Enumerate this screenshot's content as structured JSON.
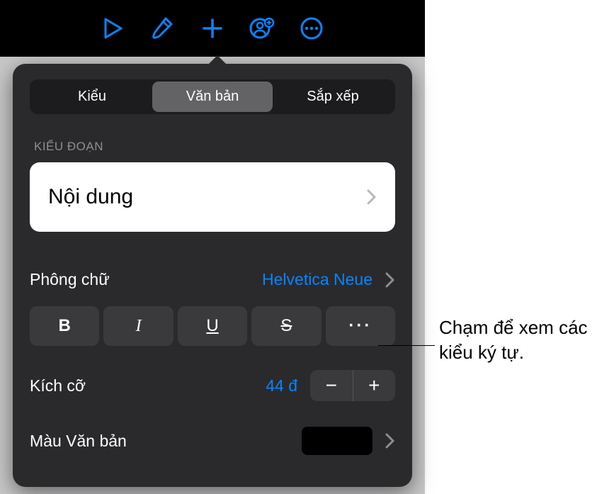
{
  "toolbar": {
    "play_icon": "play-icon",
    "brush_icon": "brush-icon",
    "add_icon": "add-icon",
    "collab_icon": "collab-icon",
    "more_icon": "more-icon"
  },
  "tabs": {
    "style": "Kiểu",
    "text": "Văn bản",
    "arrange": "Sắp xếp"
  },
  "sections": {
    "paragraph_style": "KIỂU ĐOẠN"
  },
  "paragraph_style_value": "Nội dung",
  "font": {
    "label": "Phông chữ",
    "value": "Helvetica Neue"
  },
  "style_buttons": {
    "bold": "B",
    "italic": "I",
    "underline": "U",
    "strike": "S",
    "more": "···"
  },
  "size": {
    "label": "Kích cỡ",
    "value": "44 đ"
  },
  "text_color": {
    "label": "Màu Văn bản",
    "value": "#000000"
  },
  "callout": "Chạm để xem các kiểu ký tự."
}
